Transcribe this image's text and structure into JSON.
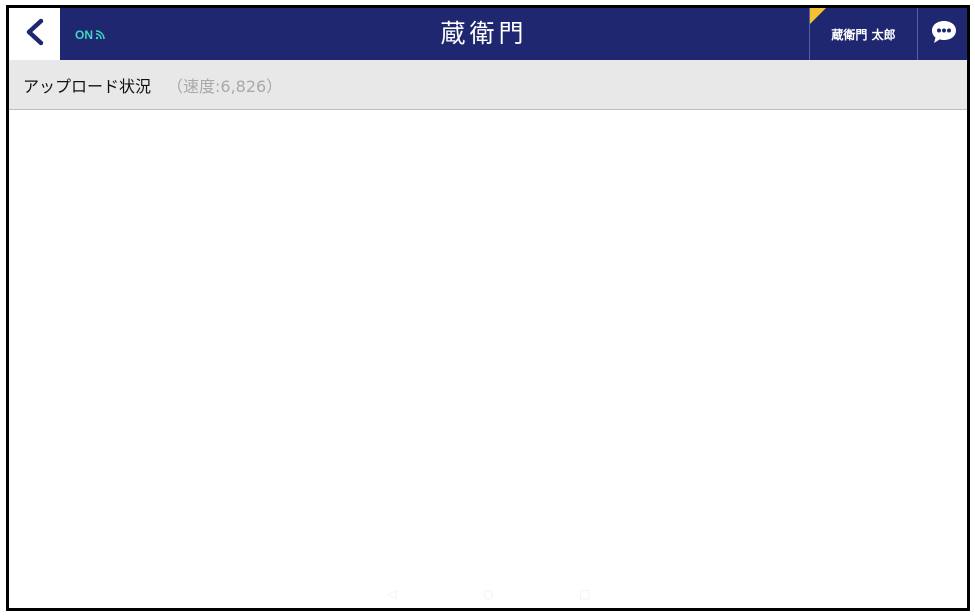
{
  "header": {
    "back_icon": "chevron-left-icon",
    "connection_status": "ON",
    "connection_icon": "wifi-signal-icon",
    "logo_text": "蔵衛門",
    "user_name": "蔵衛門 太郎",
    "chat_icon": "chat-bubble-icon",
    "colors": {
      "bar": "#1e2770",
      "status": "#3fd6c2",
      "accent_corner": "#f2c230"
    }
  },
  "subheader": {
    "title": "アップロード状況",
    "speed": "（速度:6,826）"
  },
  "system_nav": {
    "icons": [
      "back-nav-icon",
      "home-nav-icon",
      "recent-apps-nav-icon"
    ]
  }
}
